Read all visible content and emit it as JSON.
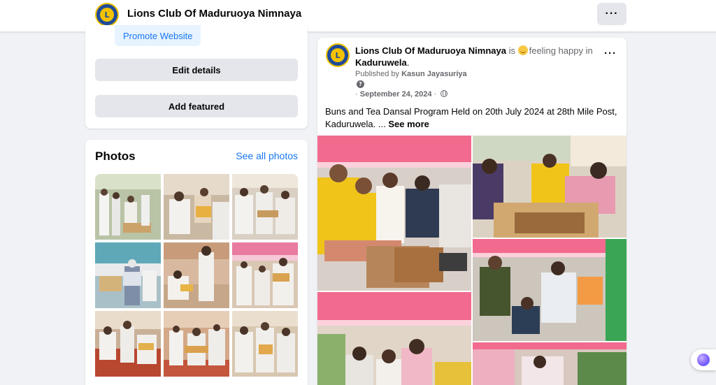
{
  "header": {
    "page_name": "Lions Club Of Maduruoya Nimnaya",
    "logo_icon": "lions-club-logo",
    "more_label": "···"
  },
  "intro": {
    "promote_label": "Promote Website",
    "edit_details_label": "Edit details",
    "add_featured_label": "Add featured"
  },
  "photos": {
    "title": "Photos",
    "see_all_label": "See all photos",
    "items": [
      "photo-1",
      "photo-2",
      "photo-3",
      "photo-4",
      "photo-5",
      "photo-6",
      "photo-7",
      "photo-8",
      "photo-9"
    ]
  },
  "post": {
    "author": "Lions Club Of Maduruoya Nimnaya",
    "is_text": "is",
    "feeling": "feeling happy in",
    "location": "Kaduruwela",
    "published_by_label": "Published by",
    "publisher": "Kasun Jayasuriya",
    "date": "September 24, 2024",
    "body": "Buns and Tea Dansal Program Held on 20th July 2024 at 28th Mile Post, Kaduruwela. ...",
    "see_more": "See more",
    "menu_label": "···"
  },
  "colors": {
    "accent": "#1877f2",
    "background": "#f0f2f5",
    "button_gray": "#e4e6eb",
    "promote_bg": "#e7f3ff"
  }
}
